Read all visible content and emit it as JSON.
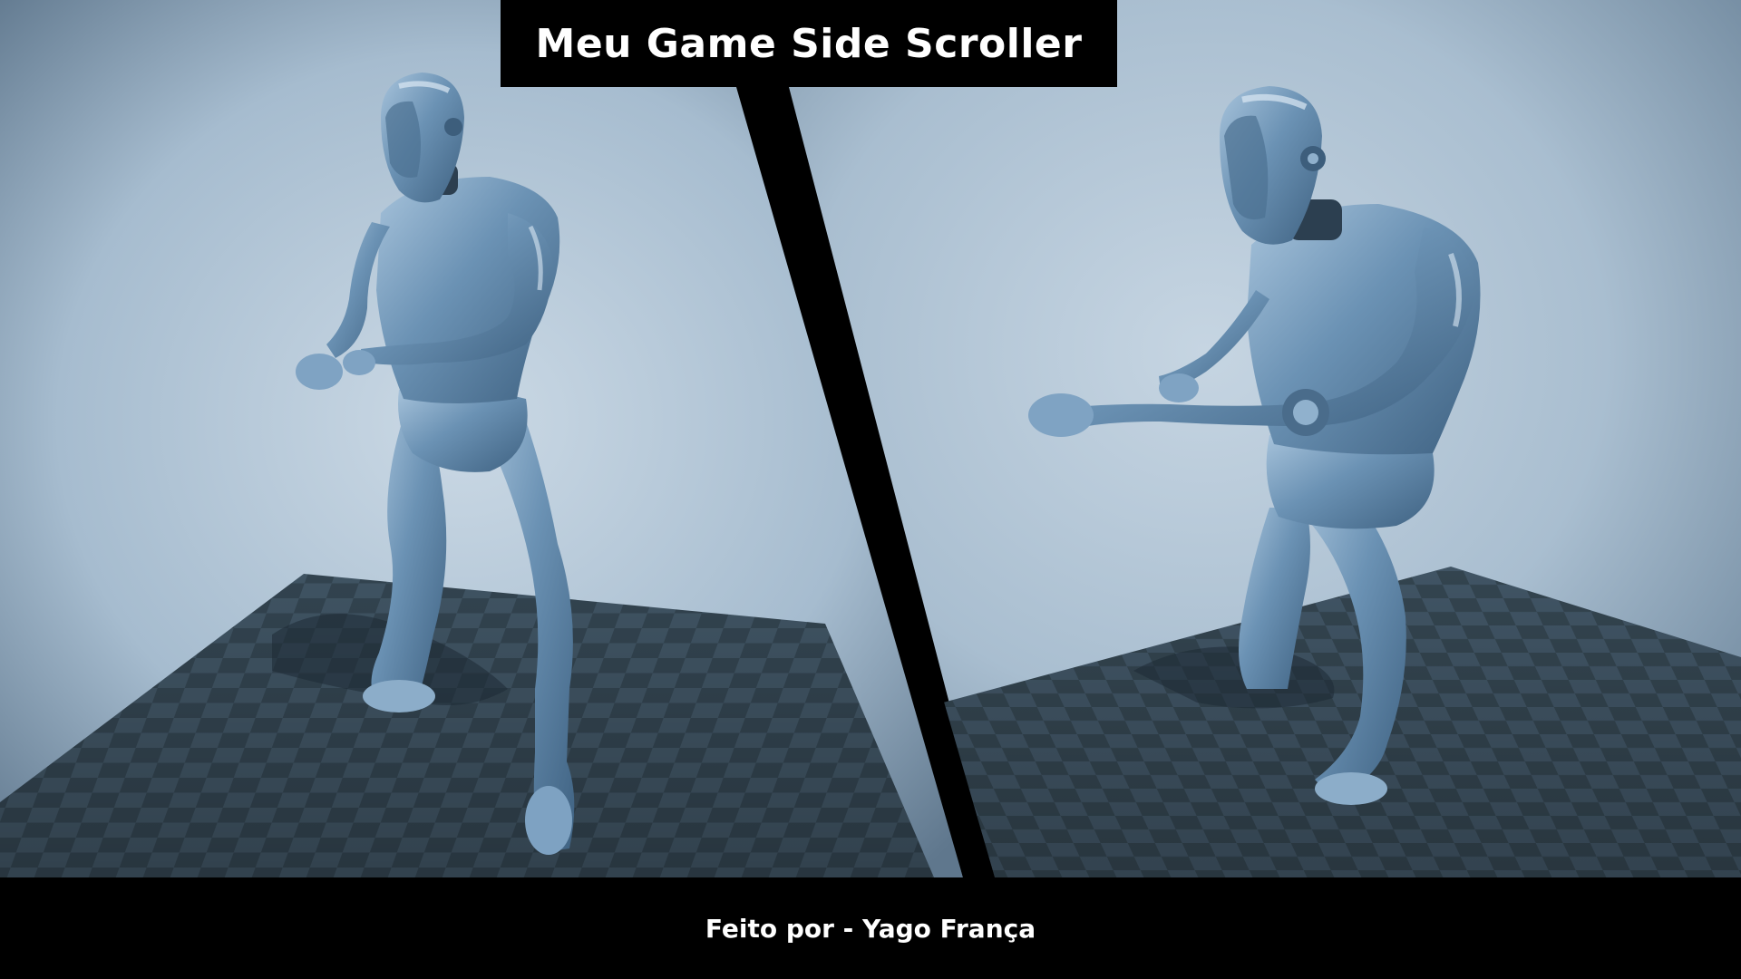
{
  "title": "Meu Game Side Scroller",
  "credit": "Feito por - Yago França",
  "colors": {
    "background_light": "#c2d2df",
    "background_dark": "#6e869c",
    "floor_dark": "#2d3d4b",
    "floor_light": "#3e5263",
    "mannequin": "#5b84a8",
    "mannequin_highlight": "#a9c6de",
    "divider": "#000000"
  },
  "scene": {
    "left_view": "mannequin-idle-pose",
    "right_view": "mannequin-reaching-pose"
  }
}
